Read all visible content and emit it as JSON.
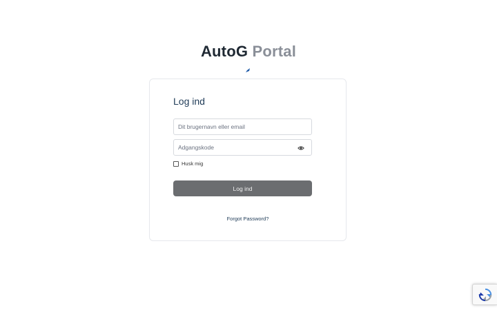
{
  "brand": {
    "name_part1": "AutoG",
    "name_part2": "Portal"
  },
  "login_form": {
    "title": "Log ind",
    "username_placeholder": "Dit brugernavn eller email",
    "password_placeholder": "Adgangskode",
    "remember_label": "Husk mig",
    "submit_label": "Log ind",
    "forgot_label": "Forgot Password?"
  },
  "colors": {
    "brand_dark": "#1f2933",
    "brand_gray": "#8a8f98",
    "title_blue": "#1f3b57",
    "button_gray": "#6b6d70",
    "accent_blue": "#1e5aa8"
  },
  "icons": {
    "password_toggle": "eye-icon",
    "captcha_badge": "recaptcha-icon",
    "brand_mark": "brand-swoosh-icon"
  }
}
